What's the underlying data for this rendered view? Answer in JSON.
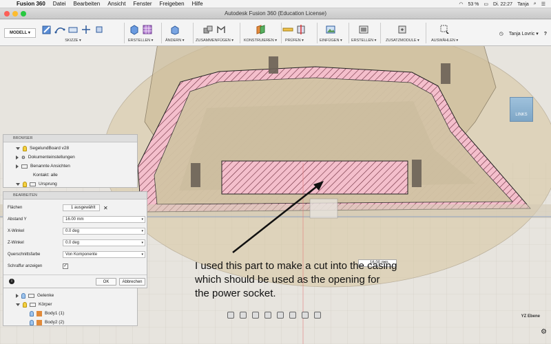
{
  "mac_menu": {
    "app_name": "Fusion 360",
    "items": [
      "Datei",
      "Bearbeiten",
      "Ansicht",
      "Fenster",
      "Freigeben",
      "Hilfe"
    ],
    "status": {
      "battery": "53 %",
      "time": "Di. 22:27",
      "user": "Tanja"
    }
  },
  "window": {
    "title": "Autodesk Fusion 360 (Education License)"
  },
  "toolbar": {
    "workspace": "MODELL ▾",
    "groups": [
      {
        "label": "SKIZZE ▾"
      },
      {
        "label": "ERSTELLEN ▾"
      },
      {
        "label": "ÄNDERN ▾"
      },
      {
        "label": "ZUSAMMENFÜGEN ▾"
      },
      {
        "label": "KONSTRUIEREN ▾"
      },
      {
        "label": "PRÜFEN ▾"
      },
      {
        "label": "EINFÜGEN ▾"
      },
      {
        "label": "ERSTELLEN ▾"
      },
      {
        "label": "ZUSATZMODULE ▾"
      },
      {
        "label": "AUSWÄHLEN ▾"
      }
    ],
    "user": "Tanja Lovric ▾",
    "help": "?"
  },
  "browser": {
    "title": "BROWSER",
    "items": [
      {
        "label": "SegelundBoard v28"
      },
      {
        "label": "Dokumenteinstellungen"
      },
      {
        "label": "Benannte Ansichten"
      },
      {
        "label": "Kontakt: alle"
      },
      {
        "label": "Ursprung"
      }
    ],
    "lower_items": [
      {
        "label": "Gelenke"
      },
      {
        "label": "Körper"
      },
      {
        "label": "Body1 (1)"
      },
      {
        "label": "Body2 (2)"
      }
    ]
  },
  "edit_panel": {
    "title": "BEARBEITEN",
    "fields": {
      "faces_label": "Flächen",
      "faces_value": "1 ausgewählt",
      "offset_label": "Abstand Y",
      "offset_value": "16.00 mm",
      "xangle_label": "X-Winkel",
      "xangle_value": "0.0 deg",
      "zangle_label": "Z-Winkel",
      "zangle_value": "0.0 deg",
      "color_label": "Querschnittsfarbe",
      "color_value": "Von Komponente",
      "hatch_label": "Schraffur anzeigen"
    },
    "ok": "OK",
    "cancel": "Abbrechen"
  },
  "viewport": {
    "dimension_value": "16.00 mm",
    "viewcube_label": "LINKS",
    "plane_label": "YZ Ebene"
  },
  "annotation": {
    "line1": "I used this part to make a cut into the casing",
    "line2": "which should be used as the opening for",
    "line3": "the power socket."
  },
  "colors": {
    "section_hatch": "#f3b8c6",
    "casing": "#d7c8a8",
    "selected_part": "#e6dac8"
  }
}
